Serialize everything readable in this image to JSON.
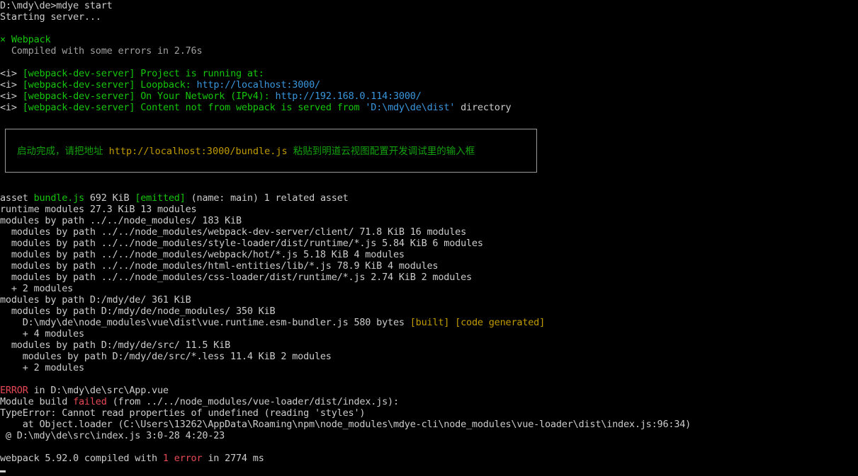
{
  "colors": {
    "background": "#000000",
    "text": "#cccccc",
    "green": "#16c60c",
    "cyan": "#3a96dd",
    "yellow": "#c19c00",
    "red": "#e74856"
  },
  "prompt": {
    "command_line": "D:\\mdy\\de>mdye start",
    "status": "Starting server..."
  },
  "webpack_status": {
    "mark": "×",
    "name": "Webpack",
    "message": "Compiled with some errors in 2.76s"
  },
  "dev_server": {
    "info_tag": "<i>",
    "server_tag": "[webpack-dev-server]",
    "running_text": "Project is running at:",
    "loopback_label": "Loopback:",
    "loopback_url": "http://localhost:3000/",
    "network_label": "On Your Network (IPv4):",
    "network_url": "http://192.168.0.114:3000/",
    "content_text": "Content not from webpack is served from",
    "content_path": "'D:\\mdy\\de\\dist'",
    "content_suffix": "directory"
  },
  "banner": {
    "prefix": "启动完成，请把地址",
    "url": "http://localhost:3000/bundle.js",
    "suffix": "粘贴到明道云视图配置开发调试里的输入框"
  },
  "build_output": {
    "asset_word": "asset",
    "asset_name": "bundle.js",
    "asset_size": "692 KiB",
    "asset_emitted": "[emitted]",
    "asset_rest": "(name: main) 1 related asset",
    "lines": [
      "runtime modules 27.3 KiB 13 modules",
      "modules by path ../../node_modules/ 183 KiB",
      "  modules by path ../../node_modules/webpack-dev-server/client/ 71.8 KiB 16 modules",
      "  modules by path ../../node_modules/style-loader/dist/runtime/*.js 5.84 KiB 6 modules",
      "  modules by path ../../node_modules/webpack/hot/*.js 5.18 KiB 4 modules",
      "  modules by path ../../node_modules/html-entities/lib/*.js 78.9 KiB 4 modules",
      "  modules by path ../../node_modules/css-loader/dist/runtime/*.js 2.74 KiB 2 modules",
      "  + 2 modules",
      "modules by path D:/mdy/de/ 361 KiB",
      "  modules by path D:/mdy/de/node_modules/ 350 KiB"
    ],
    "vue_runtime": "    D:\\mdy\\de\\node_modules\\vue\\dist\\vue.runtime.esm-bundler.js 580 bytes",
    "built_tag": "[built]",
    "code_generated_tag": "[code generated]",
    "lines2": [
      "    + 4 modules",
      "  modules by path D:/mdy/de/src/ 11.5 KiB",
      "    modules by path D:/mdy/de/src/*.less 11.4 KiB 2 modules",
      "    + 2 modules"
    ]
  },
  "error": {
    "label": "ERROR",
    "location": "in D:\\mdy\\de\\src\\App.vue",
    "module_build": "Module build",
    "failed": "failed",
    "from_text": "(from ../../node_modules/vue-loader/dist/index.js):",
    "type_error": "TypeError: Cannot read properties of undefined (reading 'styles')",
    "stack_line": "    at Object.loader (C:\\Users\\13262\\AppData\\Roaming\\npm\\node_modules\\mdye-cli\\node_modules\\vue-loader\\dist\\index.js:96:34)",
    "at_line": " @ D:\\mdy\\de\\src\\index.js 3:0-28 4:20-23"
  },
  "summary": {
    "prefix": "webpack 5.92.0 compiled with",
    "error_count": "1 error",
    "suffix": "in 2774 ms"
  }
}
